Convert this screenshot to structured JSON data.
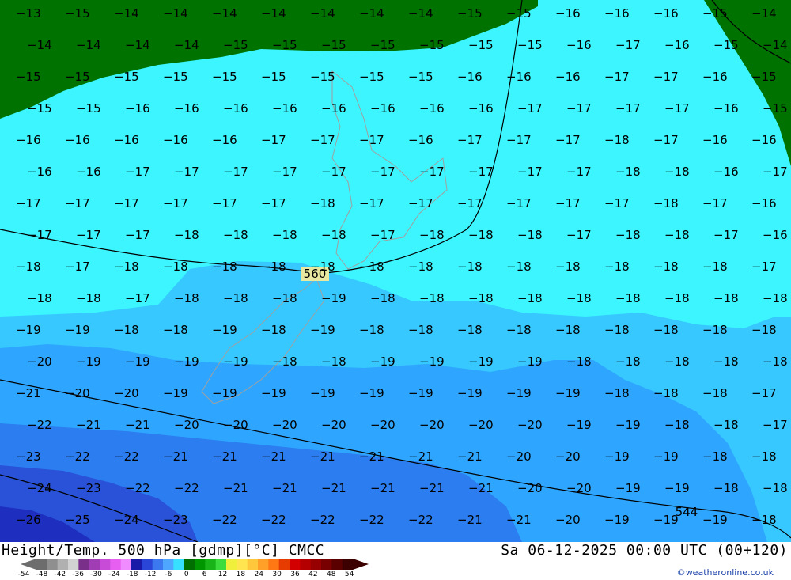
{
  "map": {
    "contour_label": "560",
    "contour_label_2": "544",
    "temperature_labels": [
      [
        "−13",
        "−15",
        "−14",
        "−14",
        "−14",
        "−14",
        "−14",
        "−14",
        "−14",
        "−15",
        "−15",
        "−16",
        "−16",
        "−16",
        "−15",
        "−14"
      ],
      [
        "−14",
        "−14",
        "−14",
        "−14",
        "−15",
        "−15",
        "−15",
        "−15",
        "−15",
        "−15",
        "−15",
        "−16",
        "−17",
        "−16",
        "−15",
        "−14"
      ],
      [
        "−15",
        "−15",
        "−15",
        "−15",
        "−15",
        "−15",
        "−15",
        "−15",
        "−15",
        "−16",
        "−16",
        "−16",
        "−17",
        "−17",
        "−16",
        "−15"
      ],
      [
        "−15",
        "−15",
        "−16",
        "−16",
        "−16",
        "−16",
        "−16",
        "−16",
        "−16",
        "−16",
        "−17",
        "−17",
        "−17",
        "−17",
        "−16",
        "−15"
      ],
      [
        "−16",
        "−16",
        "−16",
        "−16",
        "−16",
        "−17",
        "−17",
        "−17",
        "−16",
        "−17",
        "−17",
        "−17",
        "−18",
        "−17",
        "−16",
        "−16"
      ],
      [
        "−16",
        "−16",
        "−17",
        "−17",
        "−17",
        "−17",
        "−17",
        "−17",
        "−17",
        "−17",
        "−17",
        "−17",
        "−18",
        "−18",
        "−16",
        "−17"
      ],
      [
        "−17",
        "−17",
        "−17",
        "−17",
        "−17",
        "−17",
        "−18",
        "−17",
        "−17",
        "−17",
        "−17",
        "−17",
        "−17",
        "−18",
        "−17",
        "−16"
      ],
      [
        "−17",
        "−17",
        "−17",
        "−18",
        "−18",
        "−18",
        "−18",
        "−17",
        "−18",
        "−18",
        "−18",
        "−17",
        "−18",
        "−18",
        "−17",
        "−16"
      ],
      [
        "−18",
        "−17",
        "−18",
        "−18",
        "−18",
        "−18",
        "−18",
        "−18",
        "−18",
        "−18",
        "−18",
        "−18",
        "−18",
        "−18",
        "−18",
        "−17"
      ],
      [
        "−18",
        "−18",
        "−17",
        "−18",
        "−18",
        "−18",
        "−19",
        "−18",
        "−18",
        "−18",
        "−18",
        "−18",
        "−18",
        "−18",
        "−18",
        "−18"
      ],
      [
        "−19",
        "−19",
        "−18",
        "−18",
        "−19",
        "−18",
        "−19",
        "−18",
        "−18",
        "−18",
        "−18",
        "−18",
        "−18",
        "−18",
        "−18",
        "−18"
      ],
      [
        "−20",
        "−19",
        "−19",
        "−19",
        "−19",
        "−18",
        "−18",
        "−19",
        "−19",
        "−19",
        "−19",
        "−18",
        "−18",
        "−18",
        "−18",
        "−18"
      ],
      [
        "−21",
        "−20",
        "−20",
        "−19",
        "−19",
        "−19",
        "−19",
        "−19",
        "−19",
        "−19",
        "−19",
        "−19",
        "−18",
        "−18",
        "−18",
        "−17"
      ],
      [
        "−22",
        "−21",
        "−21",
        "−20",
        "−20",
        "−20",
        "−20",
        "−20",
        "−20",
        "−20",
        "−20",
        "−19",
        "−19",
        "−18",
        "−18",
        "−17"
      ],
      [
        "−23",
        "−22",
        "−22",
        "−21",
        "−21",
        "−21",
        "−21",
        "−21",
        "−21",
        "−21",
        "−20",
        "−20",
        "−19",
        "−19",
        "−18",
        "−18"
      ],
      [
        "−24",
        "−23",
        "−22",
        "−22",
        "−21",
        "−21",
        "−21",
        "−21",
        "−21",
        "−21",
        "−20",
        "−20",
        "−19",
        "−19",
        "−18",
        "−18"
      ],
      [
        "−26",
        "−25",
        "−24",
        "−23",
        "−22",
        "−22",
        "−22",
        "−22",
        "−22",
        "−21",
        "−21",
        "−20",
        "−19",
        "−19",
        "−19",
        "−18"
      ]
    ]
  },
  "footer": {
    "title": "Height/Temp. 500 hPa [gdmp][°C] CMCC",
    "datetime": "Sa 06-12-2025 00:00 UTC (00+120)",
    "credit": "©weatheronline.co.uk",
    "scale_ticks": [
      "-54",
      "-48",
      "-42",
      "-36",
      "-30",
      "-24",
      "-18",
      "-12",
      "-6",
      "0",
      "6",
      "12",
      "18",
      "24",
      "30",
      "36",
      "42",
      "48",
      "54"
    ],
    "scale_colors": [
      "#6d6d6d",
      "#8f8f8f",
      "#b0b0b0",
      "#d2d2d2",
      "#7a2f8a",
      "#a03cb4",
      "#c84bd8",
      "#e65ff0",
      "#f08cff",
      "#1a1aa8",
      "#2a46d8",
      "#3c78f0",
      "#4fa6ff",
      "#38e0ff",
      "#006e00",
      "#009600",
      "#18b418",
      "#3cdc3c",
      "#f0f03c",
      "#ffe650",
      "#ffc83c",
      "#ffa028",
      "#ff7814",
      "#e63c00",
      "#d20000",
      "#b40000",
      "#960000",
      "#780000",
      "#5a0000",
      "#3c0000"
    ]
  }
}
